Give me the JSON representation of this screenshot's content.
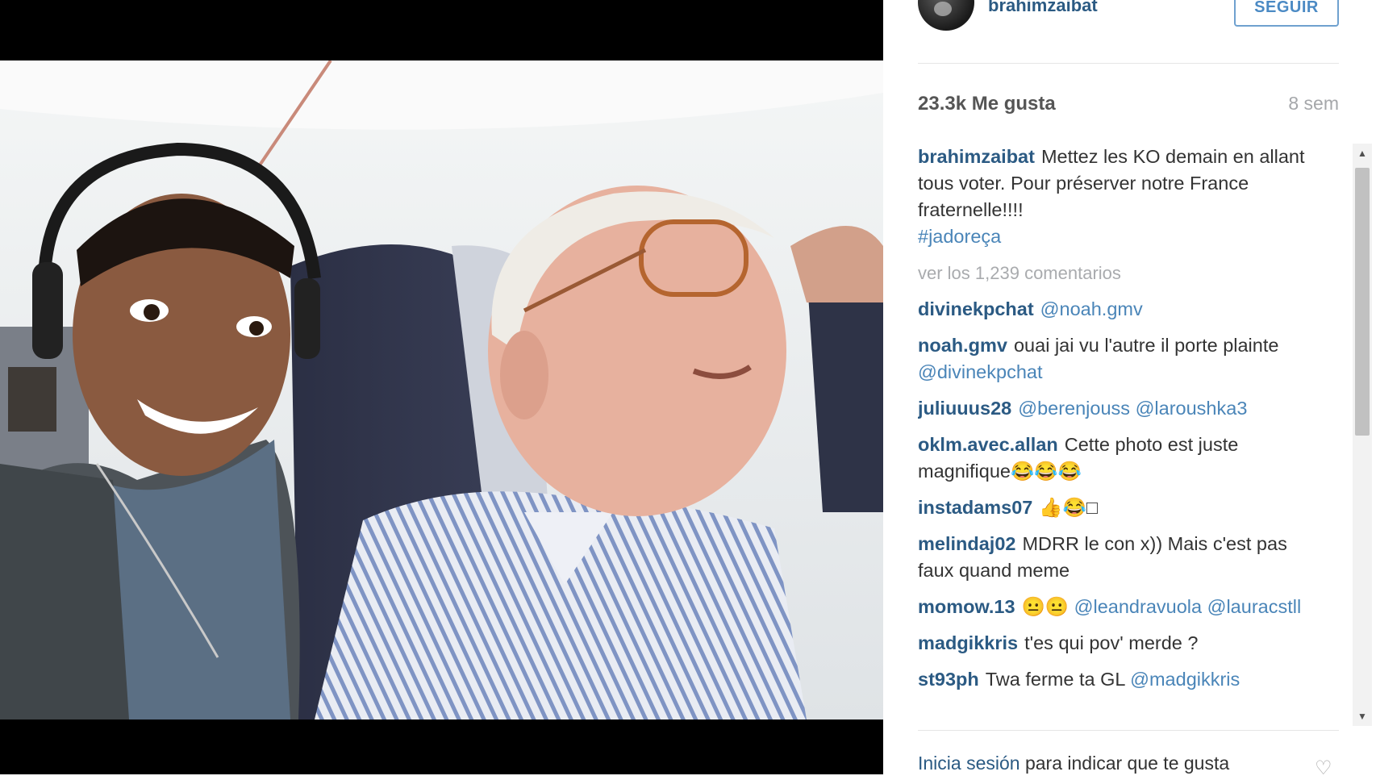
{
  "post": {
    "username": "brahimzaibat",
    "follow_label": "SEGUIR",
    "likes": "23.3k Me gusta",
    "age": "8 sem",
    "caption": {
      "user": "brahimzaibat",
      "text": "Mettez les KO demain en allant tous voter. Pour préserver notre France fraternelle!!!!",
      "hashtag": "#jadoreça"
    },
    "view_comments": "ver los 1,239 comentarios"
  },
  "comments": [
    {
      "user": "divinekpchat",
      "text": "",
      "mention": "@noah.gmv"
    },
    {
      "user": "noah.gmv",
      "text": "ouai jai vu l'autre il porte plainte",
      "mention": "@divinekpchat"
    },
    {
      "user": "juliuuus28",
      "text": "",
      "mention": "@berenjouss @laroushka3"
    },
    {
      "user": "oklm.avec.allan",
      "text": "Cette photo est juste magnifique😂😂😂",
      "mention": ""
    },
    {
      "user": "instadams07",
      "text": "👍😂□",
      "mention": ""
    },
    {
      "user": "melindaj02",
      "text": "MDRR le con x)) Mais c'est pas faux quand meme",
      "mention": ""
    },
    {
      "user": "momow.13",
      "text": "😐😐",
      "mention": "@leandravuola @lauracstll"
    },
    {
      "user": "madgikkris",
      "text": "t'es qui pov' merde ?",
      "mention": ""
    },
    {
      "user": "st93ph",
      "text": "Twa ferme ta GL",
      "mention": "@madgikkris"
    }
  ],
  "footer": {
    "login_link": "Inicia sesión",
    "login_text": "para indicar que te gusta"
  },
  "icons": {
    "avatar": "profile-avatar",
    "scroll_up": "up-arrow-icon",
    "scroll_down": "down-arrow-icon",
    "heart": "heart-icon"
  },
  "colors": {
    "username": "#2b5a83",
    "mention": "#4a85b8",
    "follow_border": "#6fa1cf"
  }
}
